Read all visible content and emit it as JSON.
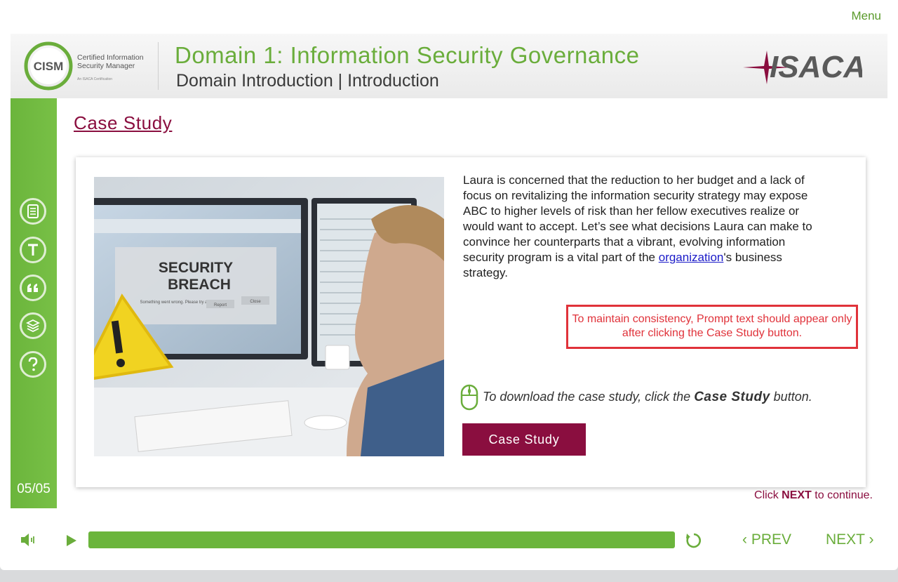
{
  "header": {
    "menu_label": "Menu",
    "cism_abbr": "CISM",
    "cism_tagline_1": "Certified Information",
    "cism_tagline_2": "Security Manager",
    "cism_tagline_sub": "An ISACA Certification",
    "domain_title": "Domain 1: Information Security Governance",
    "domain_subtitle": "Domain Introduction | Introduction",
    "brand_name": "ISACA"
  },
  "sidebar": {
    "icons": [
      "notes-icon",
      "transcript-icon",
      "quote-icon",
      "resources-icon",
      "help-icon"
    ],
    "page_counter": "05/05"
  },
  "main": {
    "heading": "Case Study",
    "body_before_link": "Laura is concerned that the reduction to her budget and a lack of focus on revitalizing the information security strategy may expose ABC to higher levels of risk than her fellow executives realize or would want to accept. Let’s see what decisions Laura can make to convince her counterparts that a vibrant, evolving information security program is a vital part of the ",
    "link_text": "organization",
    "body_after_link": "'s business strategy.",
    "image_text_1": "SECURITY",
    "image_text_2": "BREACH",
    "image_text_3": "Something went wrong. Please try again.",
    "image_btn_report": "Report",
    "image_btn_close": "Close",
    "prompt_note": "To maintain consistency, Prompt text should appear only after clicking the Case Study button.",
    "instruction_prefix": "To download the case study, click the ",
    "instruction_bold": "Case Study",
    "instruction_suffix": " button.",
    "case_button_label": "Case Study",
    "continue_prefix": "Click ",
    "continue_bold": "NEXT",
    "continue_suffix": " to continue."
  },
  "controls": {
    "prev_label": "PREV",
    "next_label": "NEXT",
    "progress": 1.0
  },
  "colors": {
    "accent_green": "#6bb53c",
    "maroon": "#8a0e3f",
    "warning_red": "#e0323a"
  }
}
